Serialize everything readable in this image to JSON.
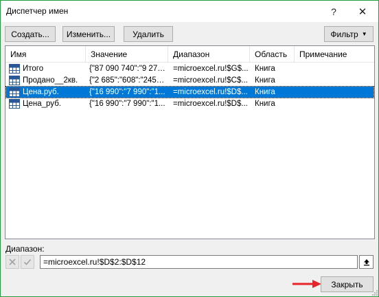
{
  "window": {
    "title": "Диспетчер имен"
  },
  "titlebar": {
    "help_glyph": "?",
    "close_glyph": "✕"
  },
  "toolbar": {
    "create_label": "Создать...",
    "edit_label": "Изменить...",
    "delete_label": "Удалить",
    "filter_label": "Фильтр"
  },
  "list": {
    "columns": [
      "Имя",
      "Значение",
      "Диапазон",
      "Область",
      "Примечание"
    ],
    "rows": [
      {
        "name": "Итого",
        "value": "{\"87 090 740\":\"9 276...",
        "range": "=microexcel.ru!$G$...",
        "scope": "Книга",
        "comment": ""
      },
      {
        "name": "Продано__2кв.",
        "value": "{\"2 685\":\"608\":\"245\":...",
        "range": "=microexcel.ru!$C$...",
        "scope": "Книга",
        "comment": ""
      },
      {
        "name": "Цена.руб.",
        "value": "{\"16 990\":\"7 990\":\"1...",
        "range": "=microexcel.ru!$D$...",
        "scope": "Книга",
        "comment": ""
      },
      {
        "name": "Цена_руб.",
        "value": "{\"16 990\":\"7 990\":\"1...",
        "range": "=microexcel.ru!$D$...",
        "scope": "Книга",
        "comment": ""
      }
    ],
    "selected_index": 2
  },
  "range_section": {
    "label": "Диапазон:",
    "value": "=microexcel.ru!$D$2:$D$12"
  },
  "footer": {
    "close_label": "Закрыть"
  },
  "colors": {
    "window_border": "#1e9c3a",
    "selection": "#0078d7",
    "annotation_arrow": "#e8232a"
  }
}
